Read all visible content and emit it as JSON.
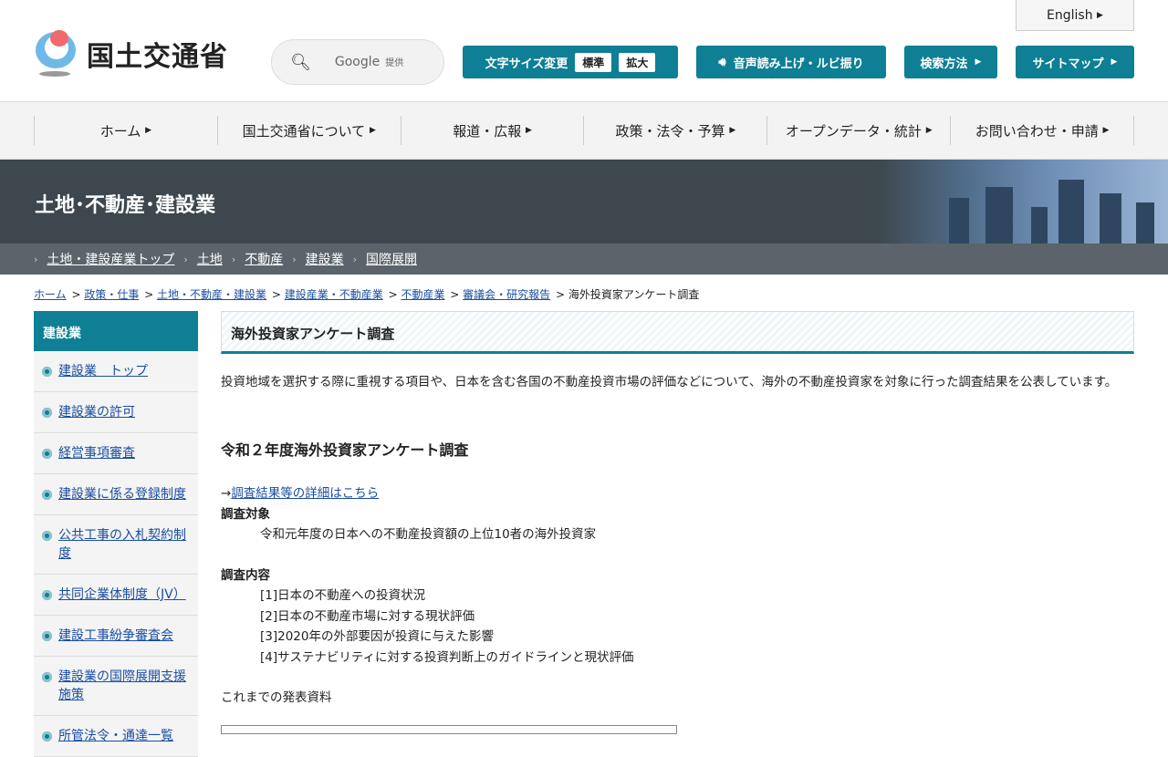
{
  "header": {
    "logo_text": "国土交通省",
    "search_label": "Google",
    "search_sub": "提供",
    "font_size_label": "文字サイズ変更",
    "font_standard": "標準",
    "font_large": "拡大",
    "speech_label": "音声読み上げ・ルビ振り",
    "search_method": "検索方法",
    "sitemap": "サイトマップ",
    "english": "English"
  },
  "nav": [
    "ホーム",
    "国土交通省について",
    "報道・広報",
    "政策・法令・予算",
    "オープンデータ・統計",
    "お問い合わせ・申請"
  ],
  "banner": {
    "title": "土地･不動産･建設業"
  },
  "subnav": [
    "土地・建設産業トップ",
    "土地",
    "不動産",
    "建設業",
    "国際展開"
  ],
  "breadcrumb": {
    "links": [
      "ホーム",
      "政策・仕事",
      "土地・不動産・建設業",
      "建設産業・不動産業",
      "不動産業",
      "審議会・研究報告"
    ],
    "current": "海外投資家アンケート調査"
  },
  "sidebar": {
    "title": "建設業",
    "items": [
      "建設業　トップ",
      "建設業の許可",
      "経営事項審査",
      "建設業に係る登録制度",
      "公共工事の入札契約制度",
      "共同企業体制度（JV）",
      "建設工事紛争審査会",
      "建設業の国際展開支援施策",
      "所管法令・通達一覧"
    ]
  },
  "main": {
    "title": "海外投資家アンケート調査",
    "description": "投資地域を選択する際に重視する項目や、日本を含む各国の不動産投資市場の評価などについて、海外の不動産投資家を対象に行った調査結果を公表しています。",
    "section_title": "令和２年度海外投資家アンケート調査",
    "arrow": "→",
    "detail_link": "調査結果等の詳細はこちら",
    "target_label": "調査対象",
    "target_text": "令和元年度の日本への不動産投資額の上位10者の海外投資家",
    "content_label": "調査内容",
    "content_items": [
      "[1]日本の不動産への投資状況",
      "[2]日本の不動産市場に対する現状評価",
      "[3]2020年の外部要因が投資に与えた影響",
      "[4]サステナビリティに対する投資判断上のガイドラインと現状評価"
    ],
    "past_label": "これまでの発表資料"
  }
}
